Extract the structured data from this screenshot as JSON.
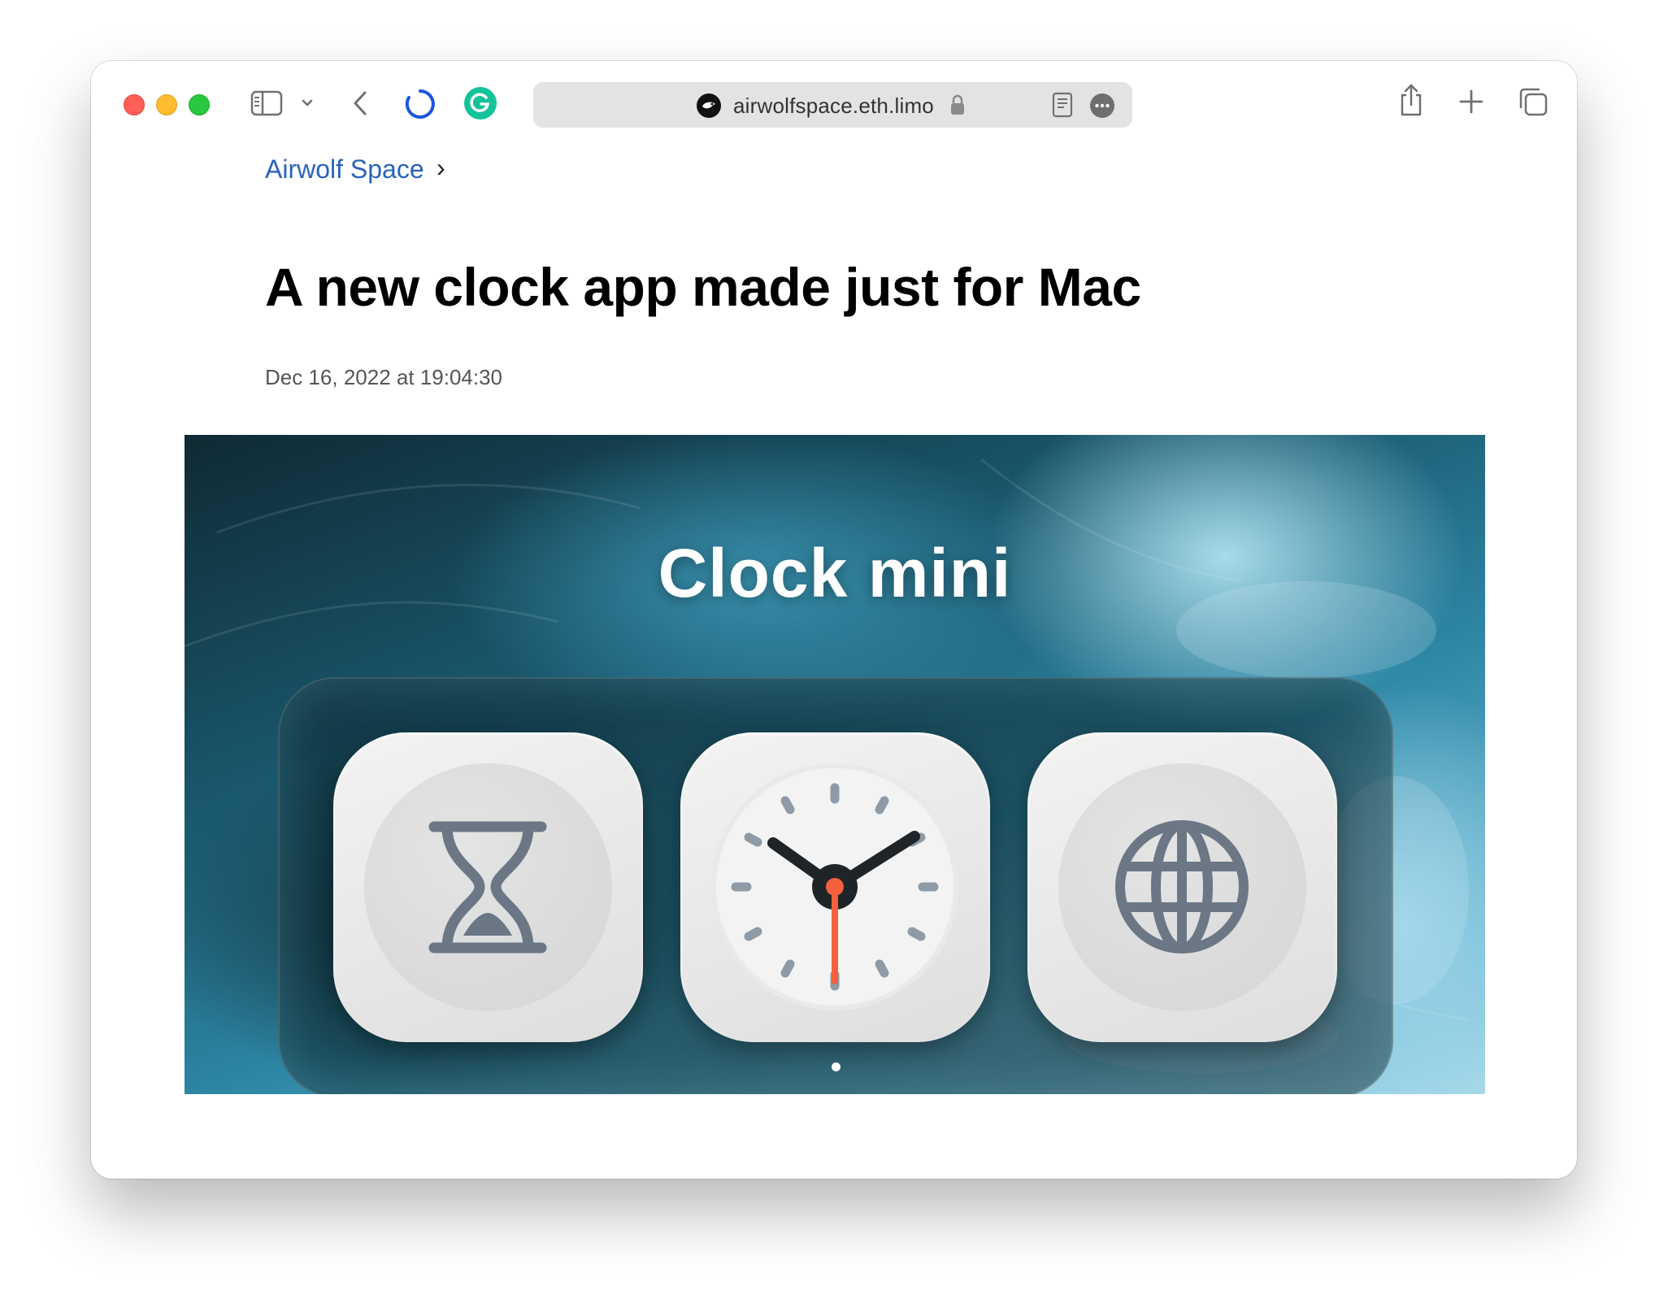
{
  "browser": {
    "url": "airwolfspace.eth.limo"
  },
  "article": {
    "breadcrumb": "Airwolf Space",
    "breadcrumb_chevron": "›",
    "title": "A new clock app made just for Mac",
    "date": "Dec 16, 2022 at 19:04:30"
  },
  "hero": {
    "title": "Clock mini",
    "apps": [
      {
        "icon": "hourglass-icon"
      },
      {
        "icon": "clock-icon"
      },
      {
        "icon": "globe-icon"
      }
    ]
  },
  "colors": {
    "link": "#2a63b8",
    "close": "#ff5f57",
    "minimize": "#febc2e",
    "maximize": "#28c840",
    "clock_second_hand": "#f2603c",
    "grammarly": "#15c39a",
    "loading_spinner": "#1a56db"
  }
}
